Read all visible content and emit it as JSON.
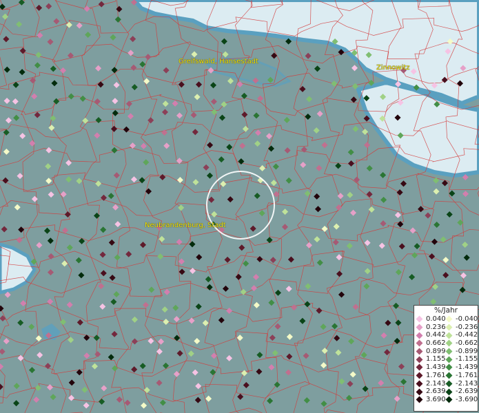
{
  "map": {
    "places": {
      "greifswald": "Greifswald, Hansestadt",
      "zinnowitz": "Zinnowitz",
      "neubrandenburg": "Neubrandenburg, Stadt"
    },
    "colors": {
      "land": "#7e9e9f",
      "water_light": "#dcecf2",
      "water_dark": "#5aa0c0",
      "boundary": "#d43a3a",
      "label": "#f2e600",
      "highlight_circle": "#ffffff"
    }
  },
  "legend": {
    "title": "%/Jahr",
    "positive": [
      {
        "label": "0.040",
        "color": "#f6c3e4"
      },
      {
        "label": "0.236",
        "color": "#e6a0c8"
      },
      {
        "label": "0.442",
        "color": "#d27fae"
      },
      {
        "label": "0.662",
        "color": "#c0708f"
      },
      {
        "label": "0.899",
        "color": "#a65a74"
      },
      {
        "label": "1.155",
        "color": "#8c4058"
      },
      {
        "label": "1.439",
        "color": "#73283d"
      },
      {
        "label": "1.761",
        "color": "#5e1a2a"
      },
      {
        "label": "2.143",
        "color": "#4a0f1e"
      },
      {
        "label": "2.639",
        "color": "#360913"
      },
      {
        "label": "3.690",
        "color": "#22040b"
      }
    ],
    "negative": [
      {
        "label": "-0.040",
        "color": "#f4fac8"
      },
      {
        "label": "-0.236",
        "color": "#dcefb0"
      },
      {
        "label": "-0.442",
        "color": "#bfe29a"
      },
      {
        "label": "-0.662",
        "color": "#a0d186"
      },
      {
        "label": "-0.899",
        "color": "#80be72"
      },
      {
        "label": "-1.155",
        "color": "#5fa65a"
      },
      {
        "label": "-1.439",
        "color": "#428e46"
      },
      {
        "label": "-1.761",
        "color": "#2a7534"
      },
      {
        "label": "-2.143",
        "color": "#175c24"
      },
      {
        "label": "-2.639",
        "color": "#0a4417"
      },
      {
        "label": "-3.690",
        "color": "#032b0c"
      }
    ]
  }
}
